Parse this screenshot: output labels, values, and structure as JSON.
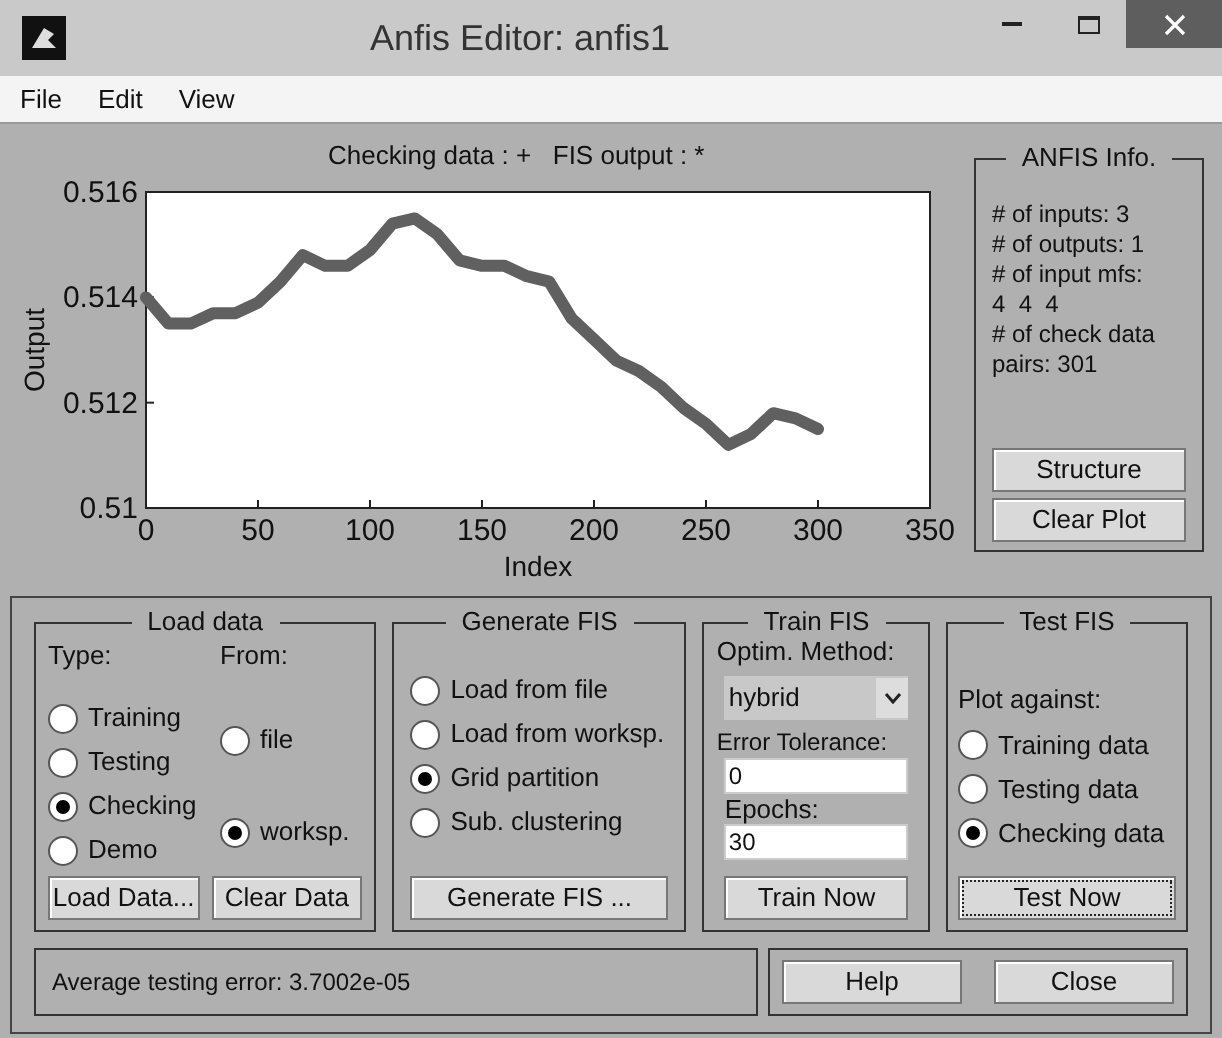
{
  "window": {
    "title": "Anfis Editor: anfis1"
  },
  "menu": [
    "File",
    "Edit",
    "View"
  ],
  "plot": {
    "chart_data": {
      "type": "line",
      "title": "Checking data : +   FIS output : *",
      "xlabel": "Index",
      "ylabel": "Output",
      "x": [
        0,
        10,
        20,
        30,
        40,
        50,
        60,
        70,
        80,
        90,
        100,
        110,
        120,
        130,
        140,
        150,
        160,
        170,
        180,
        190,
        200,
        210,
        220,
        230,
        240,
        250,
        260,
        270,
        280,
        290,
        300
      ],
      "series": [
        {
          "color": "#606060",
          "values": [
            0.514,
            0.5135,
            0.5135,
            0.5137,
            0.5137,
            0.5139,
            0.5143,
            0.5148,
            0.5146,
            0.5146,
            0.5149,
            0.5154,
            0.5155,
            0.5152,
            0.5147,
            0.5146,
            0.5146,
            0.5144,
            0.5143,
            0.5136,
            0.5132,
            0.5128,
            0.5126,
            0.5123,
            0.5119,
            0.5116,
            0.5112,
            0.5114,
            0.5118,
            0.5117,
            0.5115
          ]
        }
      ],
      "xlim": [
        0,
        350
      ],
      "ylim": [
        0.51,
        0.516
      ],
      "xticks": [
        0,
        50,
        100,
        150,
        200,
        250,
        300,
        350
      ],
      "yticks": [
        0.51,
        0.512,
        0.514,
        0.516
      ]
    }
  },
  "anfis_info": {
    "title": "ANFIS Info.",
    "lines": [
      "# of inputs: 3",
      "# of outputs: 1",
      "# of input mfs:",
      "4  4  4",
      "# of check data",
      "pairs: 301"
    ],
    "buttons": [
      "Structure",
      "Clear Plot"
    ]
  },
  "load_data": {
    "title": "Load data",
    "type_label": "Type:",
    "from_label": "From:",
    "types": [
      {
        "label": "Training",
        "selected": false
      },
      {
        "label": "Testing",
        "selected": false
      },
      {
        "label": "Checking",
        "selected": true
      },
      {
        "label": "Demo",
        "selected": false
      }
    ],
    "sources": [
      {
        "label": "file",
        "selected": false
      },
      {
        "label": "worksp.",
        "selected": true
      }
    ],
    "buttons": [
      "Load Data...",
      "Clear Data"
    ]
  },
  "generate_fis": {
    "title": "Generate FIS",
    "options": [
      {
        "label": "Load from file",
        "selected": false
      },
      {
        "label": "Load from worksp.",
        "selected": false
      },
      {
        "label": "Grid partition",
        "selected": true
      },
      {
        "label": "Sub. clustering",
        "selected": false
      }
    ],
    "button": "Generate FIS ..."
  },
  "train_fis": {
    "title": "Train FIS",
    "method_label": "Optim. Method:",
    "method": "hybrid",
    "tolerance_label": "Error Tolerance:",
    "tolerance": "0",
    "epochs_label": "Epochs:",
    "epochs": "30",
    "button": "Train Now"
  },
  "test_fis": {
    "title": "Test FIS",
    "plot_label": "Plot against:",
    "options": [
      {
        "label": "Training data",
        "selected": false
      },
      {
        "label": "Testing data",
        "selected": false
      },
      {
        "label": "Checking data",
        "selected": true
      }
    ],
    "button": "Test Now",
    "button_focused": true
  },
  "status": "Average testing error: 3.7002e-05",
  "buttons": [
    "Help",
    "Close"
  ]
}
